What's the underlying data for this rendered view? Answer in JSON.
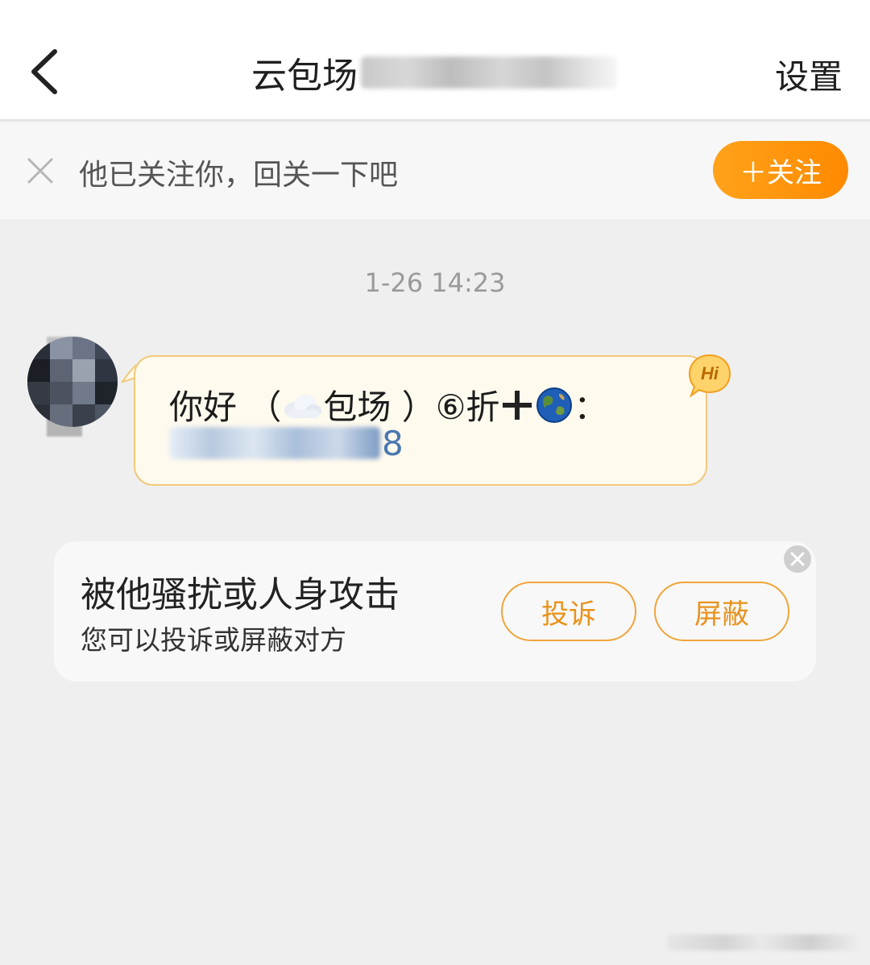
{
  "header": {
    "title": "云包场",
    "settings_label": "设置"
  },
  "follow_bar": {
    "text": "他已关注你，回关一下吧",
    "button_label": "＋关注"
  },
  "chat": {
    "timestamp": "1-26 14:23",
    "message": {
      "part1": "你好 （",
      "part2": "包场 ）⑥折",
      "part3": "：",
      "phone_visible_end": "8"
    },
    "badge": "Hi"
  },
  "safety_card": {
    "title": "被他骚扰或人身攻击",
    "subtitle": "您可以投诉或屏蔽对方",
    "report_label": "投诉",
    "block_label": "屏蔽"
  },
  "colors": {
    "accent": "#ff8a00",
    "bubble_bg": "#fffaee",
    "bubble_border": "#f2c97a",
    "link": "#4a78b0"
  },
  "icons": {
    "back": "chevron-left-icon",
    "close": "close-icon",
    "cloud": "cloud-icon",
    "plus": "plus-icon",
    "globe": "globe-icon"
  }
}
